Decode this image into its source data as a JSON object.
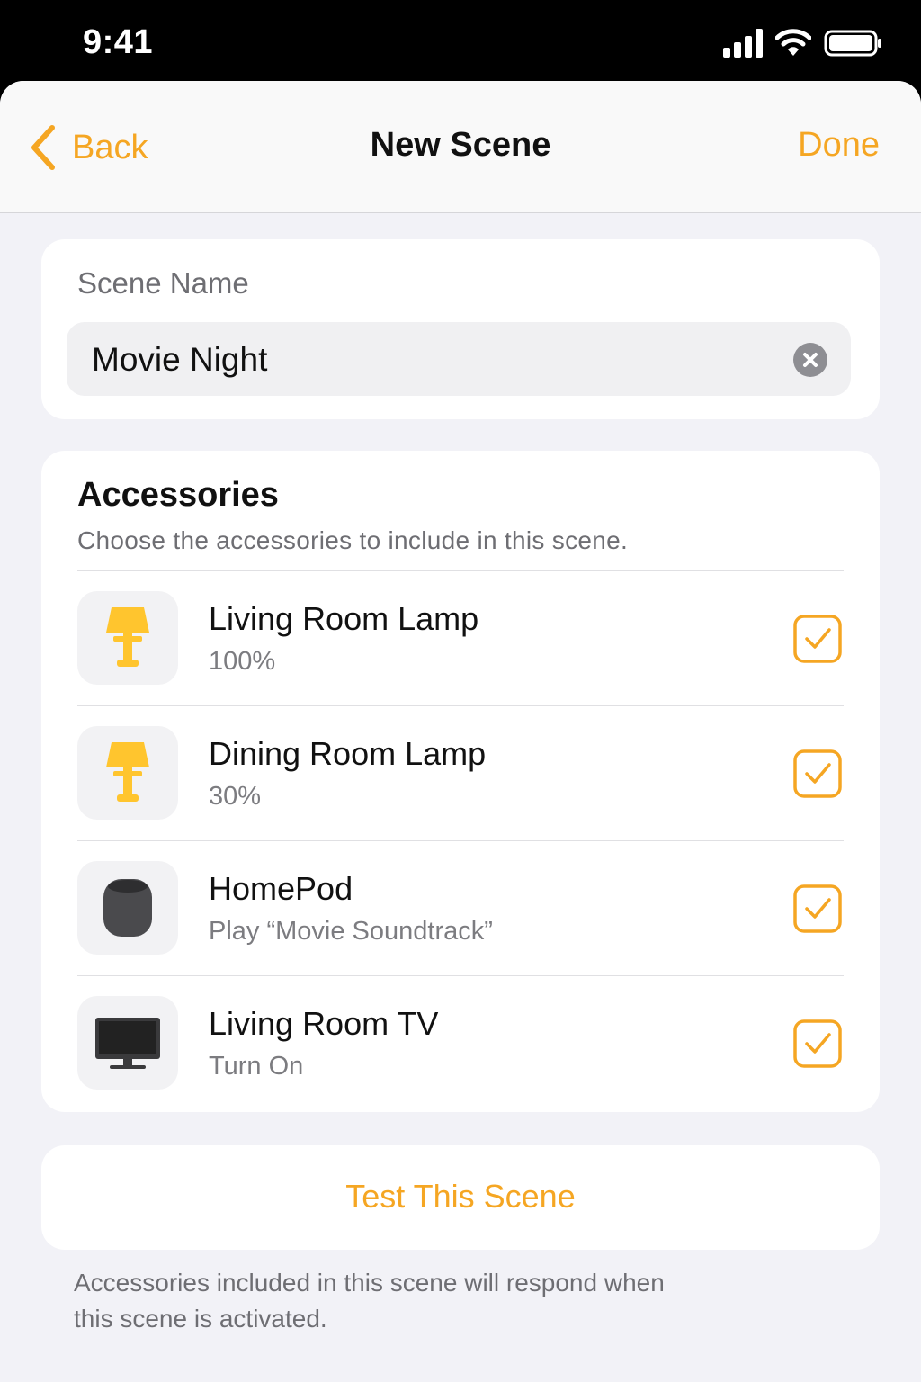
{
  "status_bar": {
    "time": "9:41",
    "icons": [
      "cellular-signal-icon",
      "wifi-icon",
      "battery-icon"
    ]
  },
  "nav": {
    "back_label": "Back",
    "title": "New Scene",
    "done_label": "Done"
  },
  "scene_name": {
    "label": "Scene Name",
    "value": "Movie Night"
  },
  "accessories": {
    "title": "Accessories",
    "subtitle": "Choose the accessories to include in this scene.",
    "items": [
      {
        "name": "Living Room Lamp",
        "status": "100%",
        "icon": "lamp-icon",
        "checked": true
      },
      {
        "name": "Dining Room Lamp",
        "status": "30%",
        "icon": "lamp-icon",
        "checked": true
      },
      {
        "name": "HomePod",
        "status": "Play “Movie Soundtrack”",
        "icon": "homepod-icon",
        "checked": true
      },
      {
        "name": "Living Room TV",
        "status": "Turn On",
        "icon": "tv-icon",
        "checked": true
      }
    ]
  },
  "test_button": {
    "label": "Test This Scene"
  },
  "footnote": "Accessories included in this scene will respond when this scene is activated.",
  "colors": {
    "accent": "#F5A623",
    "background": "#F2F2F7",
    "card": "#FFFFFF",
    "secondary_text": "#6E6E73"
  }
}
